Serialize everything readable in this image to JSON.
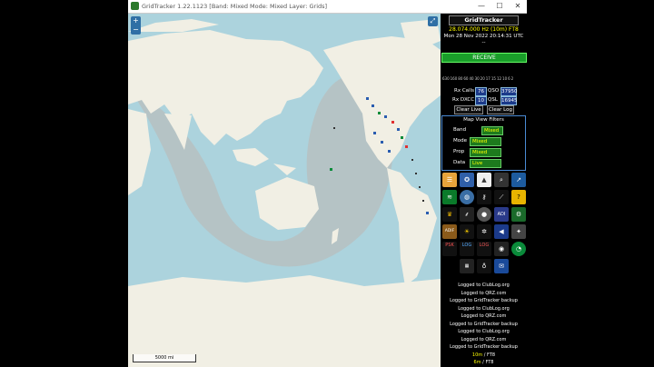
{
  "window": {
    "title": "GridTracker 1.22.1123 [Band: Mixed Mode: Mixed Layer: Grids]",
    "minimize_glyph": "—",
    "maximize_glyph": "☐",
    "close_glyph": "✕"
  },
  "map": {
    "zoom_in": "+",
    "zoom_out": "−",
    "fullscreen_glyph": "⤢",
    "scale_label": "5000 mi"
  },
  "panel": {
    "title": "GridTracker",
    "frequency": "28.074.000 Hz (10m)",
    "mode": "FT8",
    "datetime": "Mon 28 Nov 2022 20:14:31 UTC",
    "sub": "--",
    "receive_label": "RECEIVE",
    "bands": [
      "630",
      "160",
      "80",
      "60",
      "40",
      "30",
      "20",
      "17",
      "15",
      "12",
      "10",
      "6",
      "2"
    ],
    "rx_calls_label": "Rx Calls",
    "rx_calls_value": "76",
    "qso_label": "QSO",
    "qso_value": "37950",
    "rx_dxcc_label": "Rx DXCC",
    "rx_dxcc_value": "10",
    "qsl_label": "QSL",
    "qsl_value": "16945",
    "clear_live": "Clear Live",
    "clear_log": "Clear Log",
    "filters": {
      "heading": "Map View Filters",
      "rows": [
        {
          "label": "Band",
          "value": "Mixed"
        },
        {
          "label": "Mode",
          "value": "Mixed"
        },
        {
          "label": "Prop",
          "value": "Mixed"
        },
        {
          "label": "Data",
          "value": "Live"
        }
      ]
    },
    "icon_labels": {
      "adif": "ADIF",
      "psk": "PSK",
      "log": "LOG",
      "lotw": "LOG"
    },
    "log_lines": [
      "Logged to ClubLog.org",
      "Logged to QRZ.com",
      "Logged to GridTracker backup",
      "Logged to ClubLog.org",
      "Logged to QRZ.com",
      "Logged to GridTracker backup",
      "Logged to ClubLog.org",
      "Logged to QRZ.com",
      "Logged to GridTracker backup"
    ],
    "band_lines": [
      {
        "band": "10m",
        "mode": "FT8"
      },
      {
        "band": "6m",
        "mode": "FT8"
      }
    ]
  },
  "colors": {
    "ocean": "#acd3dd",
    "land": "#f1efe4",
    "night": "#b9bcba",
    "receive": "#1a9e2a",
    "accent": "#ffff00"
  }
}
